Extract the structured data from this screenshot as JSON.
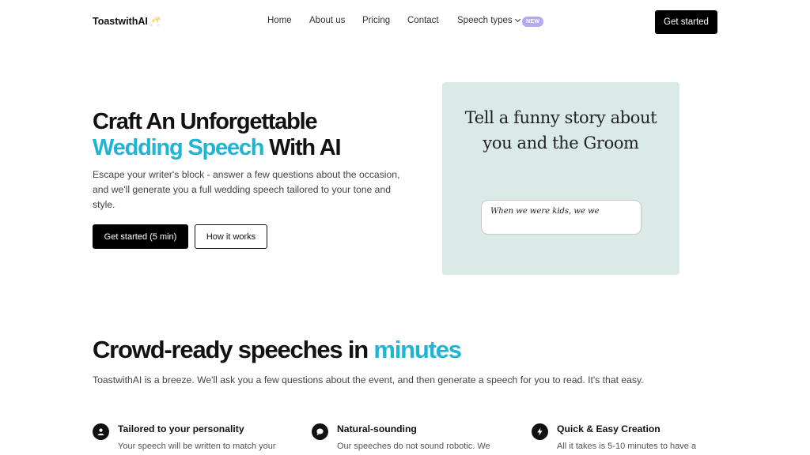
{
  "header": {
    "logo_text": "ToastwithAI",
    "logo_glyph": "🥂",
    "nav": [
      {
        "label": "Home"
      },
      {
        "label": "About us"
      },
      {
        "label": "Pricing"
      },
      {
        "label": "Contact"
      },
      {
        "label": "Speech types"
      }
    ],
    "badge": "NEW",
    "cta": "Get started"
  },
  "hero": {
    "title_line1": "Craft An Unforgettable",
    "title_accent": "Wedding Speech",
    "title_rest": " With AI",
    "description": "Escape your writer's block - answer a few questions about the occasion, and we'll generate you a full wedding speech tailored to your tone and style.",
    "primary_button": "Get started (5 min)",
    "secondary_button": "How it works"
  },
  "demo": {
    "prompt_line1": "Tell a funny story about",
    "prompt_line2": "you and the Groom",
    "input_value": "When we were kids, we we"
  },
  "section": {
    "title_main": "Crowd-ready speeches in ",
    "title_accent": "minutes",
    "description": "ToastwithAI is a breeze. We'll ask you a few questions about the event, and then generate a speech for you to read. It's that easy."
  },
  "features": [
    {
      "icon": "person-icon",
      "title": "Tailored to your personality",
      "text": "Your speech will be written to match your"
    },
    {
      "icon": "chat-bubble-icon",
      "title": "Natural-sounding",
      "text": "Our speeches do not sound robotic. We"
    },
    {
      "icon": "lightning-icon",
      "title": "Quick & Easy Creation",
      "text": "All it takes is 5-10 minutes to have a"
    }
  ],
  "colors": {
    "accent": "#1fb3d6",
    "badge": "#b7a6f5",
    "demo_bg": "#daeae7",
    "button": "#000000"
  }
}
